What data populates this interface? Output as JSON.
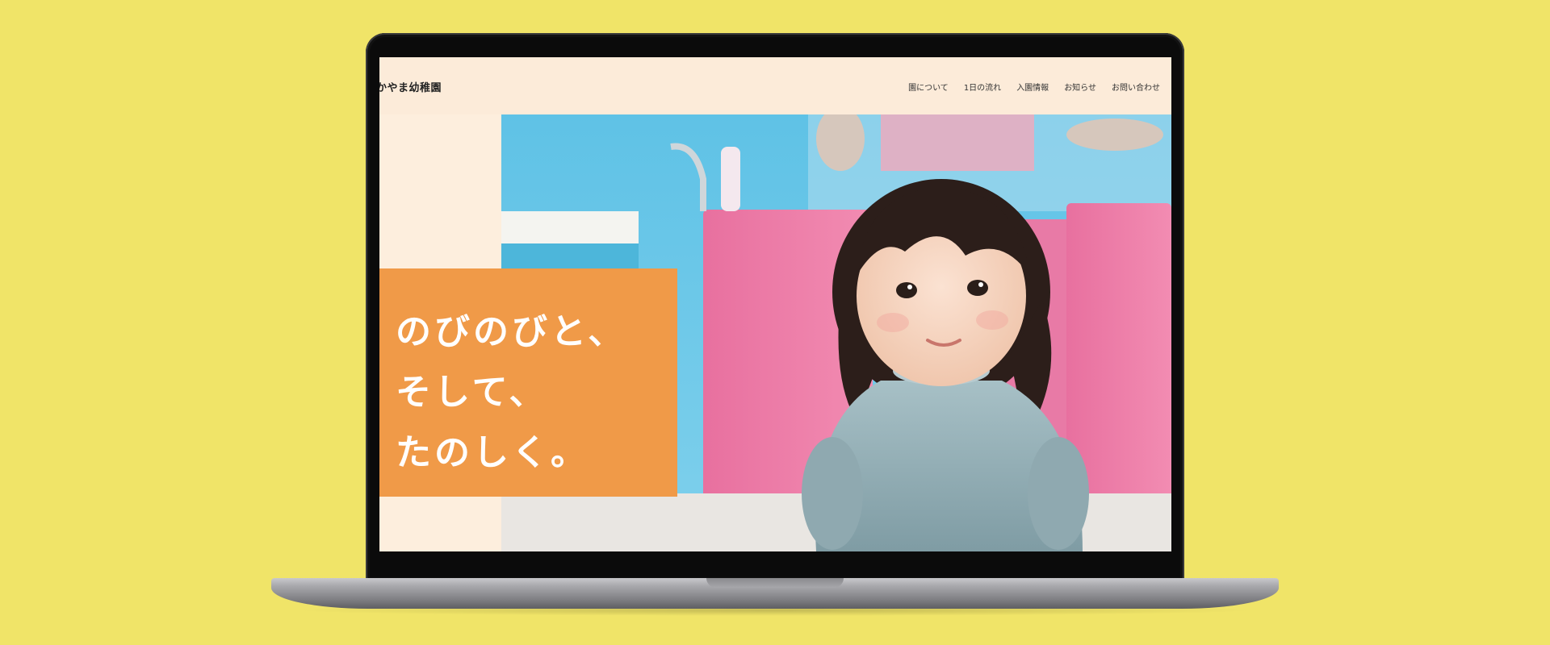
{
  "site": {
    "logo": "かやま幼稚園",
    "nav": [
      {
        "label": "園について"
      },
      {
        "label": "1日の流れ"
      },
      {
        "label": "入園情報"
      },
      {
        "label": "お知らせ"
      },
      {
        "label": "お問い合わせ"
      }
    ]
  },
  "hero": {
    "tagline_lines": [
      "のびのびと、",
      "そして、",
      "たのしく。"
    ],
    "accent_color": "#f09a48",
    "header_bg_color": "#fcebd9",
    "page_bg_color": "#f0e468"
  }
}
